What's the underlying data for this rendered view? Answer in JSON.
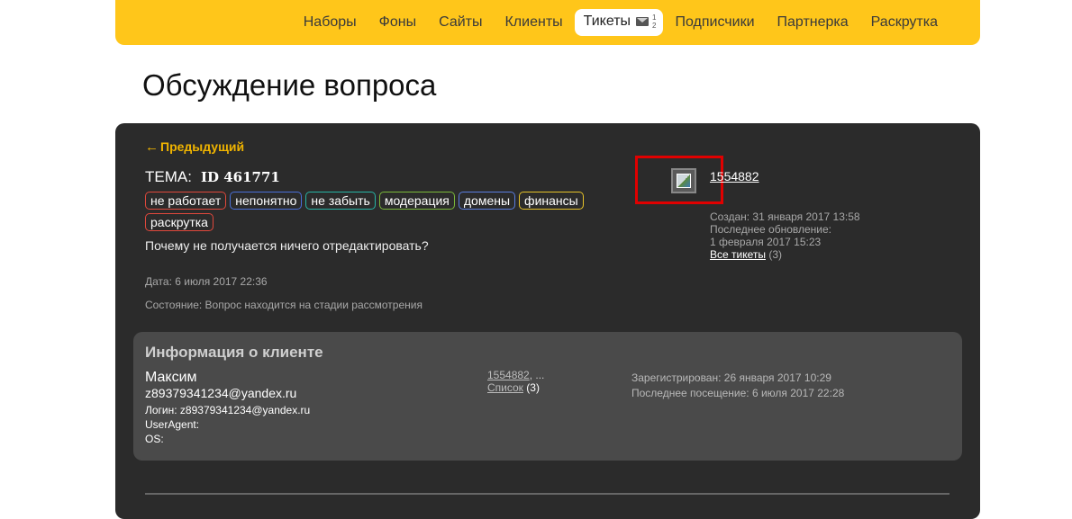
{
  "nav": {
    "items": [
      "Наборы",
      "Фоны",
      "Сайты",
      "Клиенты"
    ],
    "active": "Тикеты",
    "active_counts": [
      "1",
      "2"
    ],
    "items_after": [
      "Подписчики",
      "Партнерка",
      "Раскрутка"
    ]
  },
  "page_title": "Обсуждение вопроса",
  "ticket": {
    "prev_arrow": "←",
    "prev_label": "Предыдущий",
    "tema_label": "ТЕМА:",
    "id": "ID 461771",
    "tags": [
      {
        "label": "не работает",
        "color": "#e0483c"
      },
      {
        "label": "непонятно",
        "color": "#4a6fd8"
      },
      {
        "label": "не забыть",
        "color": "#27b5a5"
      },
      {
        "label": "модерация",
        "color": "#7ab83a"
      },
      {
        "label": "домены",
        "color": "#5b7de0"
      },
      {
        "label": "финансы",
        "color": "#e6c229"
      },
      {
        "label": "раскрутка",
        "color": "#e0483c"
      }
    ],
    "question": "Почему не получается ничего отредактировать?",
    "date": "Дата: 6 июля 2017 22:36",
    "state": "Состояние: Вопрос находится на стадии рассмотрения"
  },
  "user": {
    "id_link": "1554882",
    "created": "Создан: 31 января 2017 13:58",
    "updated_label": "Последнее обновление:",
    "updated_value": "1 февраля 2017 15:23",
    "all_tickets_label": "Все тикеты",
    "all_tickets_count": "(3)"
  },
  "client": {
    "title": "Информация о клиенте",
    "name": "Максим",
    "email": "z89379341234@yandex.ru",
    "login": "Логин: z89379341234@yandex.ru",
    "useragent": "UserAgent:",
    "os": "OS:",
    "link_id": "1554882",
    "link_more": ", ...",
    "list_label": "Список",
    "list_count": " (3)",
    "registered": "Зарегистрирован: 26 января 2017 10:29",
    "last_visit": "Последнее посещение: 6 июля 2017 22:28"
  },
  "colors": {
    "accent": "#ffc61a",
    "panel": "#2b2b2b",
    "highlight": "#e00000"
  }
}
